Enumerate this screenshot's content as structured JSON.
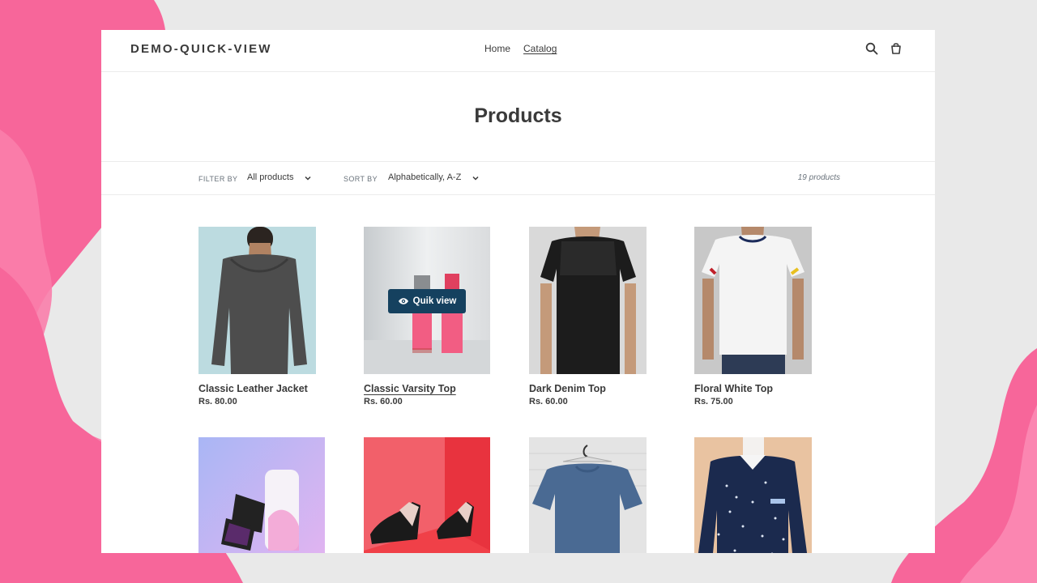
{
  "header": {
    "logo": "DEMO-QUICK-VIEW",
    "nav": [
      {
        "label": "Home"
      },
      {
        "label": "Catalog"
      }
    ]
  },
  "page": {
    "title": "Products"
  },
  "filter": {
    "filter_label": "FILTER BY",
    "filter_value": "All products",
    "sort_label": "SORT BY",
    "sort_value": "Alphabetically, A-Z",
    "count": "19 products"
  },
  "products": [
    {
      "name": "Classic Leather Jacket",
      "price": "Rs. 80.00"
    },
    {
      "name": "Classic Varsity Top",
      "price": "Rs. 60.00",
      "quick_view": "Quik view"
    },
    {
      "name": "Dark Denim Top",
      "price": "Rs. 60.00"
    },
    {
      "name": "Floral White Top",
      "price": "Rs. 75.00"
    },
    {
      "name": "",
      "price": ""
    },
    {
      "name": "",
      "price": ""
    },
    {
      "name": "",
      "price": ""
    },
    {
      "name": "",
      "price": ""
    }
  ],
  "colors": {
    "accent_pink": "#f7669a",
    "quick_view_bg": "#15415f",
    "text": "#3a3a3a"
  }
}
